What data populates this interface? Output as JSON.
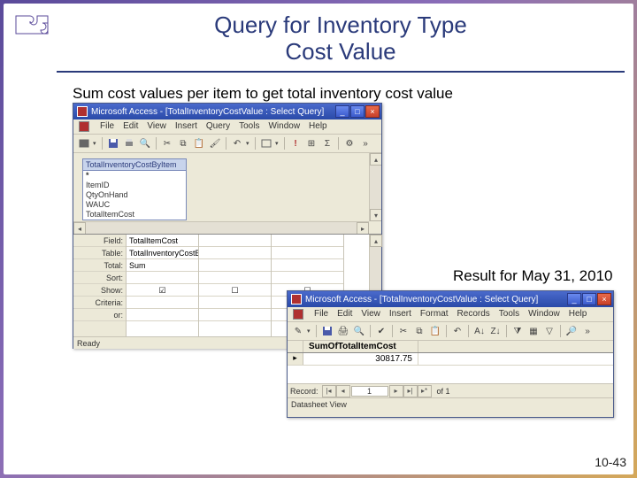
{
  "slide": {
    "title_line1": "Query for Inventory Type",
    "title_line2": "Cost Value",
    "subtitle": "Sum cost values per item to get total inventory cost value",
    "result_label": "Result for May 31, 2010",
    "page_number": "10-43"
  },
  "design_window": {
    "titlebar": "Microsoft Access - [TotalInventoryCostValue : Select Query]",
    "menus": [
      "File",
      "Edit",
      "View",
      "Insert",
      "Query",
      "Tools",
      "Window",
      "Help"
    ],
    "fieldlist": {
      "title": "TotalInventoryCostByItem",
      "fields": [
        "*",
        "ItemID",
        "QtyOnHand",
        "WAUC",
        "TotalItemCost"
      ]
    },
    "grid_row_labels": [
      "Field:",
      "Table:",
      "Total:",
      "Sort:",
      "Show:",
      "Criteria:",
      "or:"
    ],
    "col1": {
      "field": "TotalItemCost",
      "table": "TotalInventoryCostByItem",
      "total": "Sum",
      "sort": "",
      "show_checked": true,
      "criteria": "",
      "or": ""
    },
    "col2_show_checked": false,
    "col3_show_checked": false,
    "status": "Ready"
  },
  "result_window": {
    "titlebar": "Microsoft Access - [TotalInventoryCostValue : Select Query]",
    "menus": [
      "File",
      "Edit",
      "View",
      "Insert",
      "Format",
      "Records",
      "Tools",
      "Window",
      "Help"
    ],
    "column_header": "SumOfTotalItemCost",
    "value": "30817.75",
    "record_label": "Record:",
    "record_current": "1",
    "record_of": "of 1",
    "status": "Datasheet View"
  }
}
